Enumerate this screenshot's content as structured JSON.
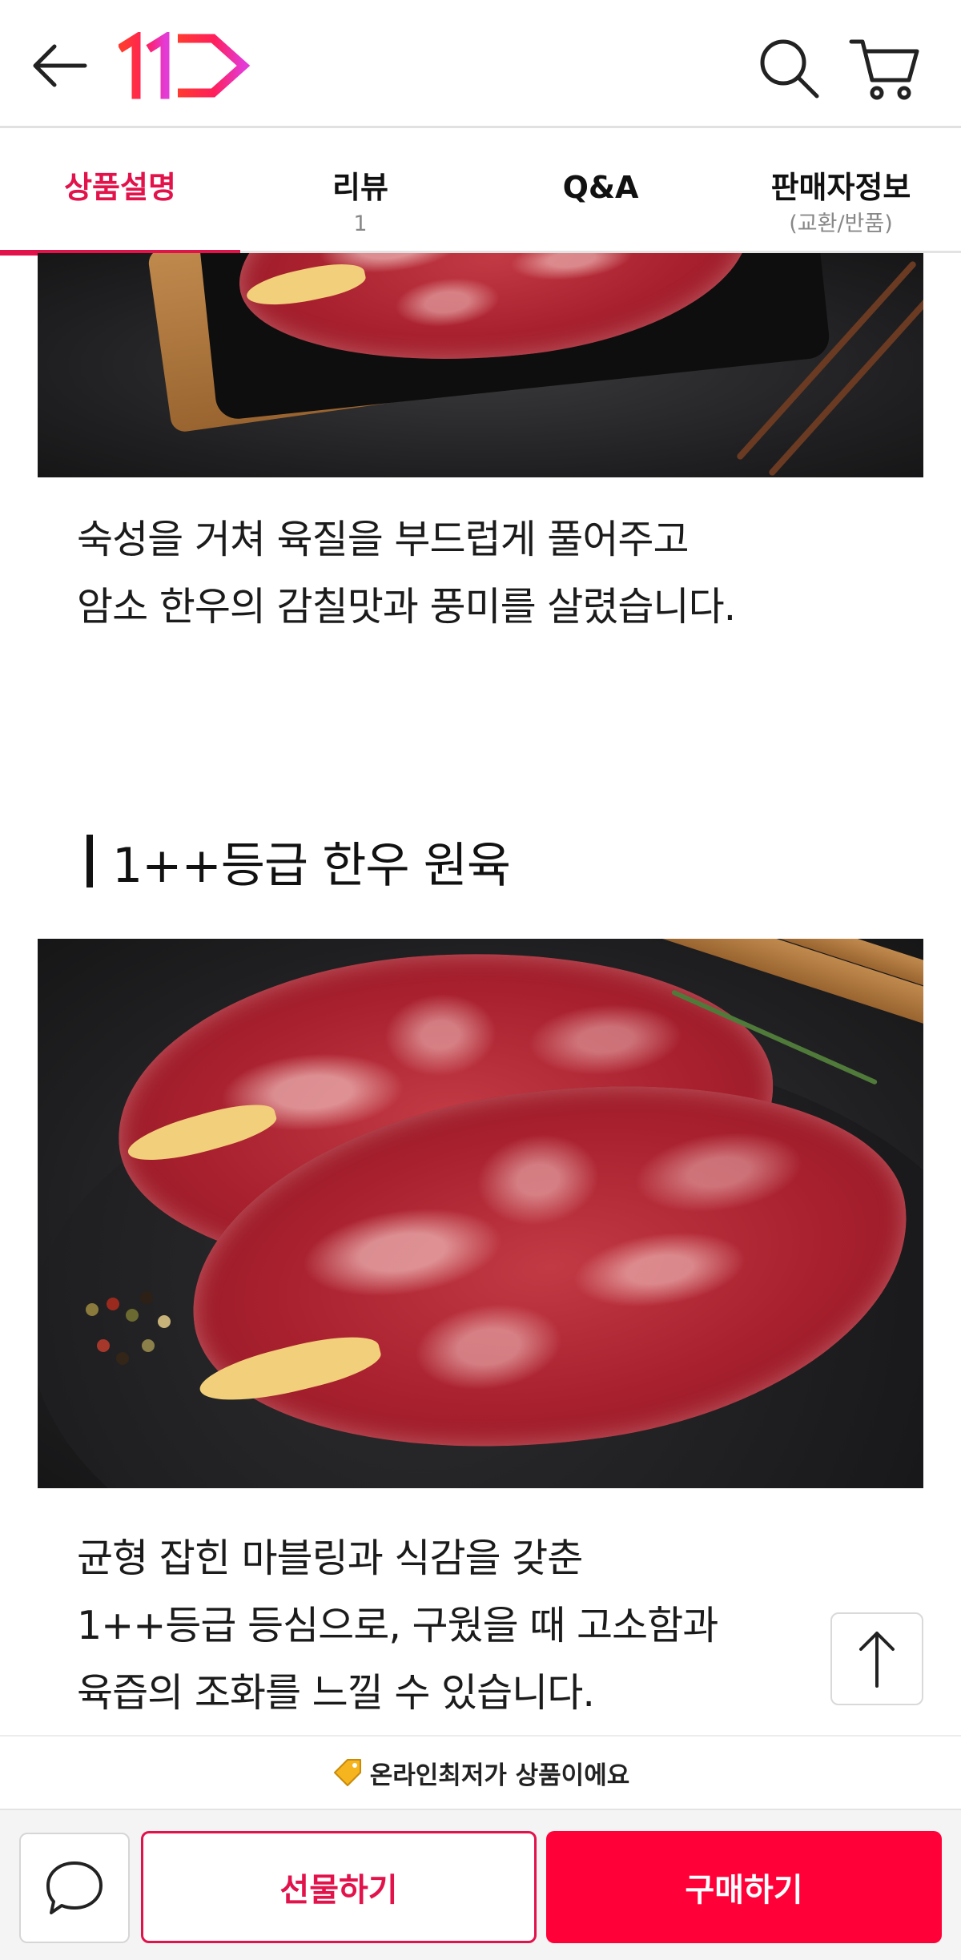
{
  "header": {
    "logo_text": "11",
    "brand_color": "#e2124b"
  },
  "tabs": [
    {
      "label": "상품설명",
      "sub": "",
      "active": true
    },
    {
      "label": "리뷰",
      "sub": "1",
      "active": false
    },
    {
      "label": "Q&A",
      "sub": "",
      "active": false
    },
    {
      "label": "판매자정보",
      "sub": "(교환/반품)",
      "active": false
    }
  ],
  "content": {
    "paragraph1": [
      "숙성을 거쳐 육질을 부드럽게 풀어주고",
      "암소 한우의 감칠맛과 풍미를 살렸습니다."
    ],
    "section_title": "1++등급 한우 원육",
    "paragraph2": [
      "균형 잡힌 마블링과 식감을 갖춘",
      "1++등급 등심으로, 구웠을 때 고소함과",
      "육즙의 조화를 느낄 수 있습니다."
    ]
  },
  "notice": {
    "icon": "price-tag-icon",
    "text": "온라인최저가 상품이에요"
  },
  "bottom_bar": {
    "gift_label": "선물하기",
    "buy_label": "구매하기",
    "accent_color": "#ff0038"
  }
}
